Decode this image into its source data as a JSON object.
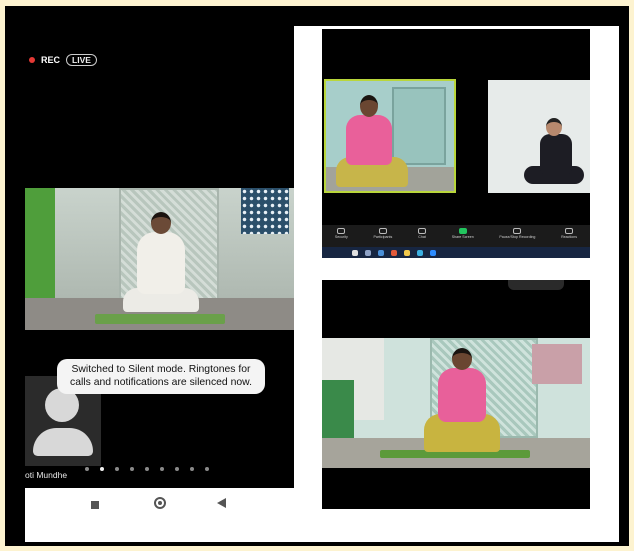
{
  "phone": {
    "rec_label": "REC",
    "live_label": "LIVE",
    "toast_text": "Switched to Silent mode. Ringtones for calls and notifications are silenced now.",
    "participant_name": "oti Mundhe",
    "page_dots": 9,
    "active_dot": 1
  },
  "zoom_toolbar": {
    "items": [
      {
        "label": "Security",
        "icon": "shield-icon"
      },
      {
        "label": "Participants",
        "icon": "participants-icon"
      },
      {
        "label": "Chat",
        "icon": "chat-icon"
      },
      {
        "label": "Share Screen",
        "icon": "share-screen-icon"
      },
      {
        "label": "Pause/Stop Recording",
        "icon": "record-icon"
      },
      {
        "label": "Reactions",
        "icon": "reactions-icon"
      }
    ]
  },
  "colors": {
    "page_background": "#fdf3d0",
    "active_speaker_border": "#b9d63b",
    "share_button": "#22c55e",
    "rec_dot": "#e53935"
  }
}
